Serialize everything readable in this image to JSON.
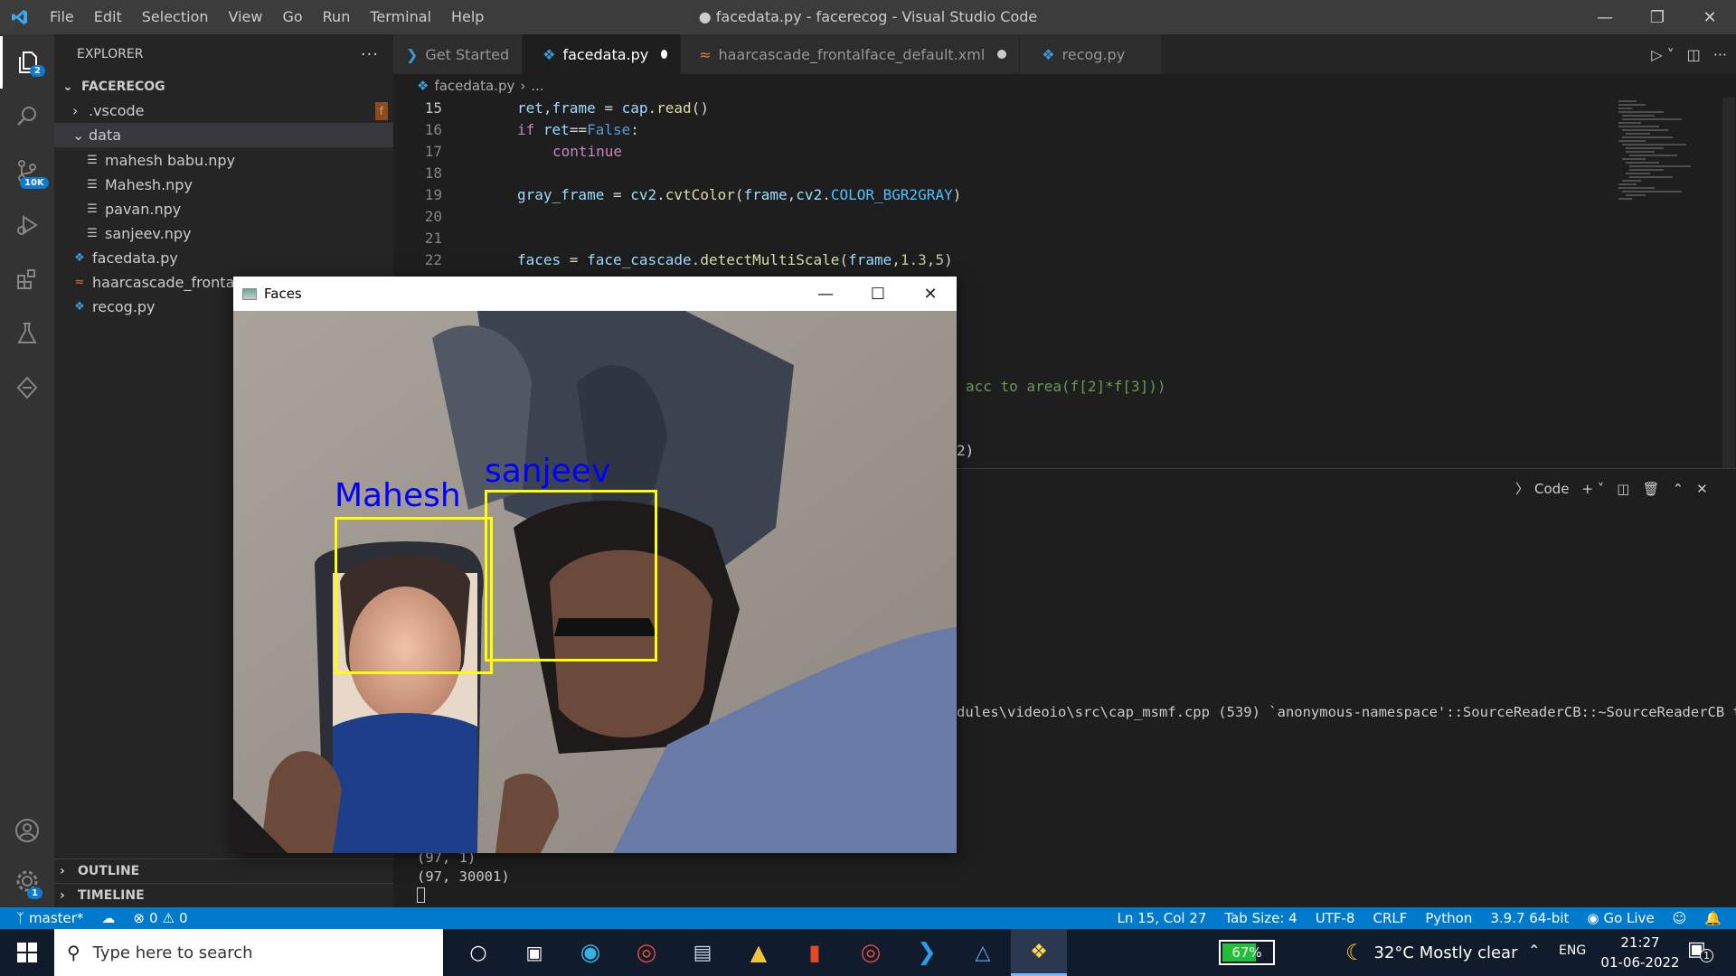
{
  "window": {
    "title": "● facedata.py - facerecog - Visual Studio Code"
  },
  "menu": [
    "File",
    "Edit",
    "Selection",
    "View",
    "Go",
    "Run",
    "Terminal",
    "Help"
  ],
  "activity_badges": {
    "explorer": "2",
    "scm": "10K",
    "settings": "1"
  },
  "sidebar": {
    "header": "EXPLORER",
    "root": "FACERECOG",
    "items": [
      {
        "label": ".vscode",
        "type": "folder-collapsed"
      },
      {
        "label": "data",
        "type": "folder-open"
      },
      {
        "label": "mahesh babu.npy",
        "type": "file"
      },
      {
        "label": "Mahesh.npy",
        "type": "file"
      },
      {
        "label": "pavan.npy",
        "type": "file"
      },
      {
        "label": "sanjeev.npy",
        "type": "file"
      },
      {
        "label": "facedata.py",
        "type": "python"
      },
      {
        "label": "haarcascade_frontalfa",
        "type": "xml"
      },
      {
        "label": "recog.py",
        "type": "python"
      }
    ],
    "vscode_badge": "f",
    "outline": "OUTLINE",
    "timeline": "TIMELINE"
  },
  "tabs": [
    {
      "label": "Get Started",
      "active": false,
      "dirty": false
    },
    {
      "label": "facedata.py",
      "active": true,
      "dirty": true
    },
    {
      "label": "haarcascade_frontalface_default.xml",
      "active": false,
      "dirty": true
    },
    {
      "label": "recog.py",
      "active": false,
      "dirty": false
    }
  ],
  "breadcrumb": {
    "file": "facedata.py",
    "rest": "..."
  },
  "code": {
    "l15": "15",
    "l16": "16",
    "l17": "17",
    "l18": "18",
    "l19": "19",
    "l20": "20",
    "l21": "21",
    "l22": "22",
    "c15a": "ret,frame",
    "c15b": " = ",
    "c15c": "cap",
    "c15d": ".",
    "c15e": "read",
    "c15f": "()",
    "c16a": "if ",
    "c16b": "ret",
    "c16c": "==",
    "c16d": "False",
    "c16e": ":",
    "c17": "continue",
    "c19a": "gray_frame",
    "c19b": " = ",
    "c19c": "cv2",
    "c19d": ".",
    "c19e": "cvtColor",
    "c19f": "(",
    "c19g": "frame",
    "c19h": ",",
    "c19i": "cv2",
    "c19j": ".",
    "c19k": "COLOR_BGR2GRAY",
    "c19l": ")",
    "c22a": "faces",
    "c22b": " = ",
    "c22c": "face_cascade",
    "c22d": ".",
    "c22e": "detectMultiScale",
    "c22f": "(",
    "c22g": "frame",
    "c22h": ",",
    "c22i": "1.3",
    "c22j": ",",
    "c22k": "5",
    "c22l": ")",
    "frag1": "acc to area(f[2]*f[3]))",
    "frag2": "2)"
  },
  "panel": {
    "code_label": "Code",
    "terminal_line": "dules\\videoio\\src\\cap_msmf.cpp (539) `anonymous-namespace'::SourceReaderCB::~SourceReaderCB t",
    "out1": "(97, 1)",
    "out2": "(97, 30001)"
  },
  "faces_window": {
    "title": "Faces",
    "labels": [
      {
        "name": "Mahesh"
      },
      {
        "name": "sanjeev"
      }
    ]
  },
  "status": {
    "branch": "master*",
    "errors": "0",
    "warnings": "0",
    "position": "Ln 15, Col 27",
    "tabsize": "Tab Size: 4",
    "encoding": "UTF-8",
    "eol": "CRLF",
    "language": "Python",
    "interpreter": "3.9.7 64-bit",
    "golive": "Go Live"
  },
  "taskbar": {
    "search_placeholder": "Type here to search",
    "battery": "67%",
    "weather": "32°C  Mostly clear",
    "lang": "ENG",
    "time": "21:27",
    "date": "01-06-2022",
    "notif": "1"
  },
  "colors": {
    "accent": "#007acc",
    "box": "#ffff00",
    "label": "#0000ff"
  }
}
